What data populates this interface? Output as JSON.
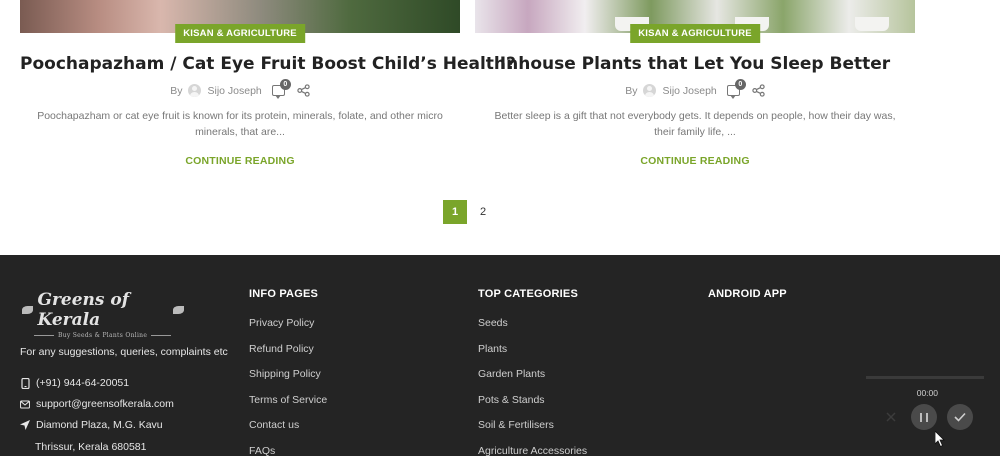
{
  "posts": [
    {
      "category": "KISAN & AGRICULTURE",
      "title": "Poochapazham / Cat Eye Fruit Boost Child’s Health?",
      "by": "By",
      "author": "Sijo Joseph",
      "comments": "0",
      "excerpt": "Poochapazham or cat eye fruit is known for its protein, minerals, folate, and other micro minerals, that are...",
      "read_more": "CONTINUE READING"
    },
    {
      "category": "KISAN & AGRICULTURE",
      "title": "Inhouse Plants that Let You Sleep Better",
      "by": "By",
      "author": "Sijo Joseph",
      "comments": "0",
      "excerpt": "Better sleep is a gift that not everybody gets. It depends on people, how their day was, their family life, ...",
      "read_more": "CONTINUE READING"
    }
  ],
  "pagination": {
    "pages": [
      "1",
      "2"
    ],
    "current": "1"
  },
  "footer": {
    "logo_text": "Greens of Kerala",
    "logo_tagline": "Buy Seeds & Plants Online",
    "suggest": "For any suggestions, queries, complaints etc",
    "phone": "(+91) 944-64-20051",
    "email": "support@greensofkerala.com",
    "address_line1": "Diamond Plaza, M.G. Kavu",
    "address_line2": "Thrissur, Kerala 680581",
    "info_heading": "INFO PAGES",
    "info_links": [
      "Privacy Policy",
      "Refund Policy",
      "Shipping Policy",
      "Terms of Service",
      "Contact us",
      "FAQs"
    ],
    "cat_heading": "TOP CATEGORIES",
    "cat_links": [
      "Seeds",
      "Plants",
      "Garden Plants",
      "Pots & Stands",
      "Soil & Fertilisers",
      "Agriculture Accessories"
    ],
    "app_heading": "ANDROID APP"
  },
  "recorder": {
    "time": "00:00"
  },
  "colors": {
    "accent": "#7aa52a",
    "footer_bg": "#242424"
  },
  "icons": [
    "avatar-icon",
    "comment-icon",
    "share-icon",
    "phone-icon",
    "mail-icon",
    "location-icon",
    "close-icon",
    "pause-icon",
    "check-icon",
    "cursor-icon"
  ]
}
